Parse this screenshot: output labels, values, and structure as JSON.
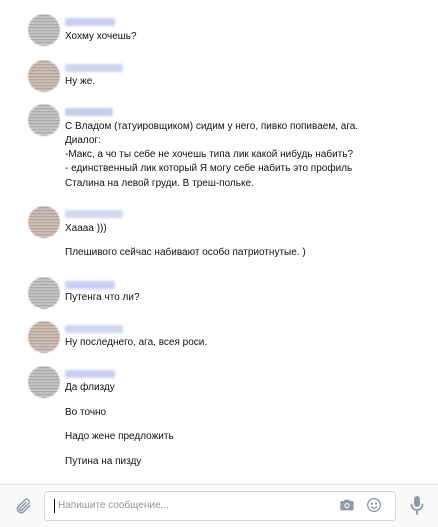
{
  "messages": [
    {
      "lines": [
        "Хохму хочешь?"
      ]
    },
    {
      "lines": [
        "Ну же."
      ]
    },
    {
      "lines": [
        "С Владом (татуировщиком) сидим у него, пивко попиваем, ага.",
        "Диалог:",
        "-Макс, а чо ты себе не хочешь типа лик какой нибудь набить?",
        "- единственный лик который Я могу себе набить это профиль",
        "Сталина на левой груди. В треш-польке."
      ]
    },
    {
      "lines": [
        "Хаааа )))"
      ]
    },
    {
      "lines": [
        "Плешивого сейчас набивают особо патриотнутые. )"
      ]
    },
    {
      "lines": [
        "Путенга что ли?"
      ]
    },
    {
      "lines": [
        "Ну последнего, ага, всея роси."
      ]
    },
    {
      "lines": [
        "Да флизду"
      ]
    },
    {
      "lines": [
        "Во точно"
      ]
    },
    {
      "lines": [
        "Надо жене предложить"
      ]
    },
    {
      "lines": [
        "Путина на пизду"
      ]
    }
  ],
  "composer": {
    "placeholder": "Напишите сообщение...",
    "icons": [
      "paperclip-icon",
      "camera-icon",
      "smile-icon",
      "microphone-icon"
    ]
  },
  "colors": {
    "background": "#ffffff",
    "composer_bg": "#fafafa",
    "icon": "#8d99a6",
    "placeholder": "#959595"
  }
}
